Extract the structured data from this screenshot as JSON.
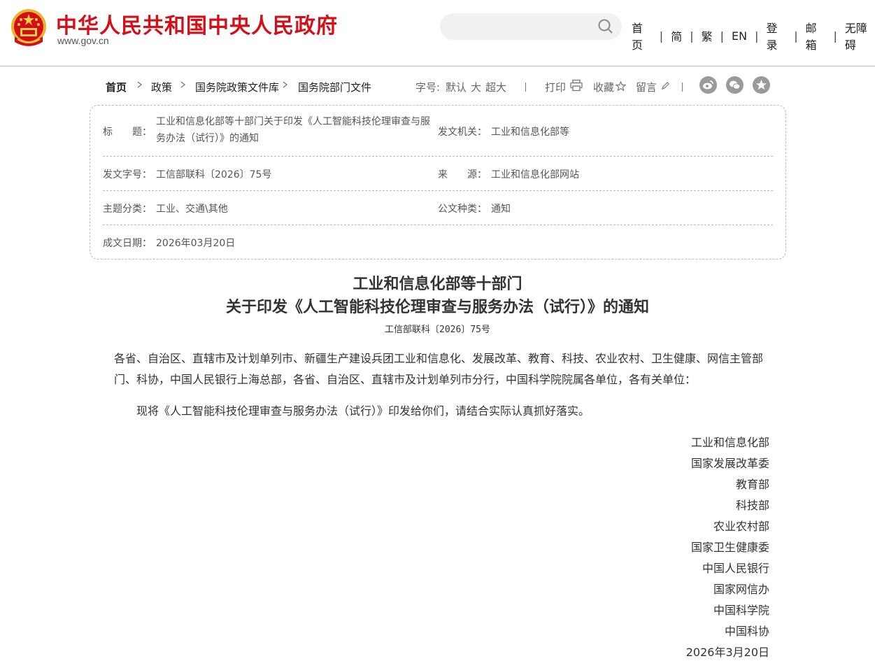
{
  "header": {
    "site_title": "中华人民共和国中央人民政府",
    "site_url": "www.gov.cn",
    "search_placeholder": "",
    "nav": [
      "首页",
      "简",
      "繁",
      "EN",
      "登录",
      "邮箱",
      "无障碍"
    ]
  },
  "breadcrumb": [
    "首页",
    "政策",
    "国务院政策文件库",
    "国务院部门文件"
  ],
  "tools": {
    "font_size_label": "字号:",
    "font_default": "默认",
    "font_large": "大",
    "font_xlarge": "超大",
    "print": "打印",
    "favorite": "收藏",
    "comment": "留言"
  },
  "social": [
    "weibo-icon",
    "wechat-icon",
    "favorite-star-icon"
  ],
  "info": {
    "title_label": "标　　题：",
    "title_value": "工业和信息化部等十部门关于印发《人工智能科技伦理审查与服务办法（试行）》的通知",
    "issuer_label": "发文机关：",
    "issuer_value": "工业和信息化部等",
    "doc_no_label": "发文字号：",
    "doc_no_value": "工信部联科〔2026〕75号",
    "source_label": "来　　源：",
    "source_value": "工业和信息化部网站",
    "topic_label": "主题分类：",
    "topic_value": "工业、交通\\其他",
    "type_label": "公文种类：",
    "type_value": "通知",
    "date_label": "成文日期：",
    "date_value": "2026年03月20日"
  },
  "document": {
    "title_line1": "工业和信息化部等十部门",
    "title_line2": "关于印发《人工智能科技伦理审查与服务办法（试行）》的通知",
    "doc_number": "工信部联科〔2026〕75号",
    "addressee": "各省、自治区、直辖市及计划单列市、新疆生产建设兵团工业和信息化、发展改革、教育、科技、农业农村、卫生健康、网信主管部门、科协，中国人民银行上海总部，各省、自治区、直辖市及计划单列市分行，中国科学院院属各单位，各有关单位：",
    "body": "现将《人工智能科技伦理审查与服务办法（试行）》印发给你们，请结合实际认真抓好落实。",
    "signers": [
      "工业和信息化部",
      "国家发展改革委",
      "教育部",
      "科技部",
      "农业农村部",
      "国家卫生健康委",
      "中国人民银行",
      "国家网信办",
      "中国科学院",
      "中国科协"
    ],
    "date": "2026年3月20日"
  },
  "colors": {
    "brand_red": "#d40f17",
    "accent_blue": "#1b4f8c"
  }
}
